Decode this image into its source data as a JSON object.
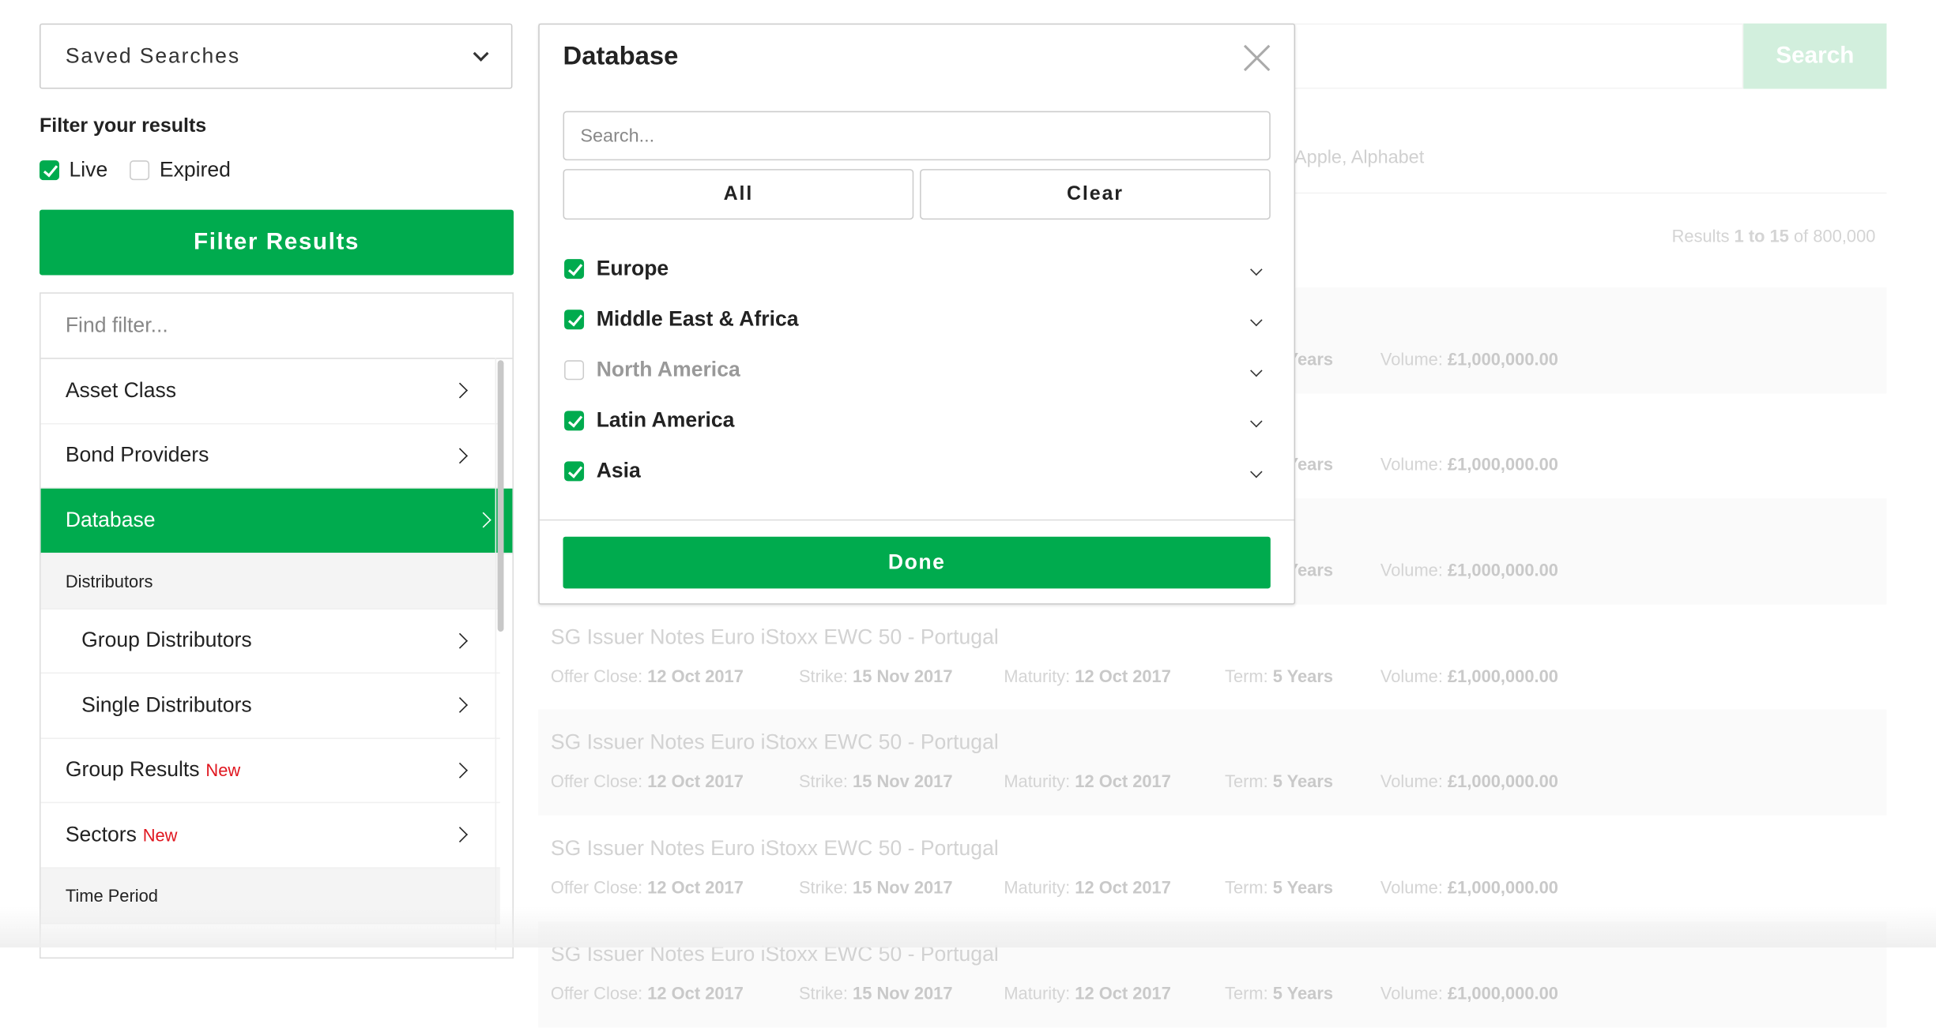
{
  "sidebar": {
    "saved_searches": "Saved Searches",
    "filter_heading": "Filter your results",
    "live": {
      "label": "Live",
      "checked": true
    },
    "expired": {
      "label": "Expired",
      "checked": false
    },
    "filter_button": "Filter Results",
    "find_placeholder": "Find filter...",
    "items": [
      {
        "label": "Asset Class",
        "type": "item"
      },
      {
        "label": "Bond Providers",
        "type": "item"
      },
      {
        "label": "Database",
        "type": "active"
      },
      {
        "label": "Distributors",
        "type": "head"
      },
      {
        "label": "Group Distributors",
        "type": "indent"
      },
      {
        "label": "Single Distributors",
        "type": "indent"
      },
      {
        "label": "Group Results",
        "badge": "New",
        "type": "item"
      },
      {
        "label": "Sectors",
        "badge": "New",
        "type": "item"
      },
      {
        "label": "Time Period",
        "type": "head"
      }
    ]
  },
  "main": {
    "search_button": "Search",
    "hint": "- Apple, Alphabet",
    "results_count": {
      "prefix": "Results ",
      "range": "1 to 15",
      "mid": " of ",
      "total": "800,000"
    },
    "row_title": "SG Issuer Notes Euro iStoxx EWC 50 - Portugal",
    "meta": {
      "offer_label": "Offer Close: ",
      "offer": "12 Oct 2017",
      "strike_label": "Strike: ",
      "strike": "15 Nov 2017",
      "maturity_label": "Maturity: ",
      "maturity": "12 Oct 2017",
      "term_label": "Term: ",
      "term": "5 Years",
      "volume_label": "Volume: ",
      "volume": "£1,000,000.00"
    }
  },
  "modal": {
    "title": "Database",
    "search_placeholder": "Search...",
    "all_button": "All",
    "clear_button": "Clear",
    "options": [
      {
        "label": "Europe",
        "checked": true
      },
      {
        "label": "Middle East & Africa",
        "checked": true
      },
      {
        "label": "North America",
        "checked": false
      },
      {
        "label": "Latin America",
        "checked": true
      },
      {
        "label": "Asia",
        "checked": true
      }
    ],
    "done_button": "Done"
  },
  "colors": {
    "accent": "#00ab4e",
    "new_badge": "#e0161f",
    "search_button_disabled": "#d2efdd"
  }
}
